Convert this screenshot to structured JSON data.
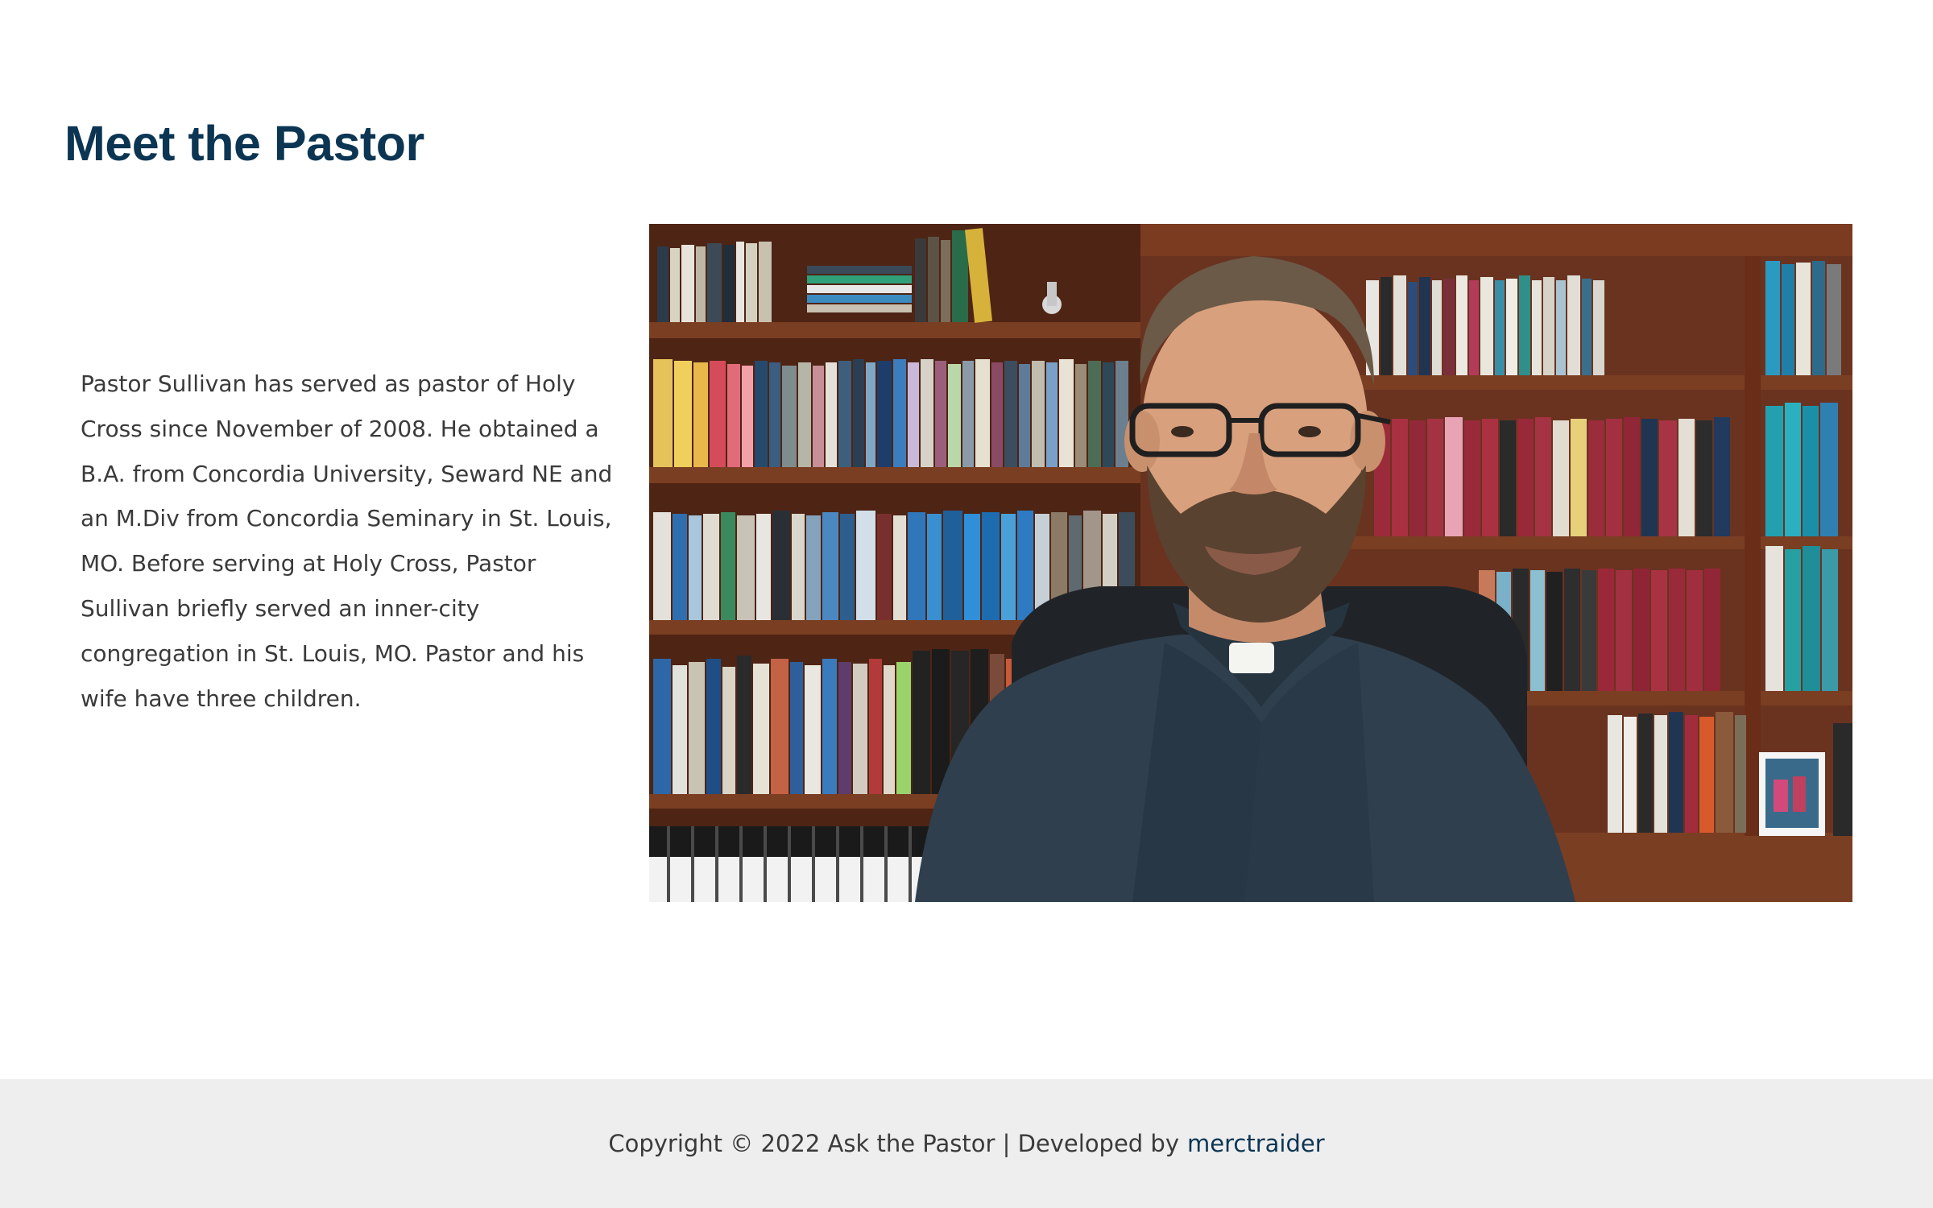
{
  "page": {
    "title": "Meet the Pastor"
  },
  "bio": {
    "text": "Pastor Sullivan has served as pastor of Holy Cross since November of 2008. He obtained a B.A. from Concordia University, Seward NE and an M.Div from Concordia Seminary in St. Louis, MO. Before serving at Holy Cross, Pastor Sullivan briefly served an inner-city congregation in St. Louis, MO. Pastor and his wife have three children."
  },
  "photo": {
    "alt": "Pastor Sullivan"
  },
  "footer": {
    "copyright": "Copyright © 2022 Ask the Pastor | Developed by",
    "developer_link": "merctraider"
  },
  "colors": {
    "heading": "#0b3553",
    "body_text": "#3a3a3a",
    "footer_bg": "#eeeeee",
    "link": "#0b3553"
  }
}
